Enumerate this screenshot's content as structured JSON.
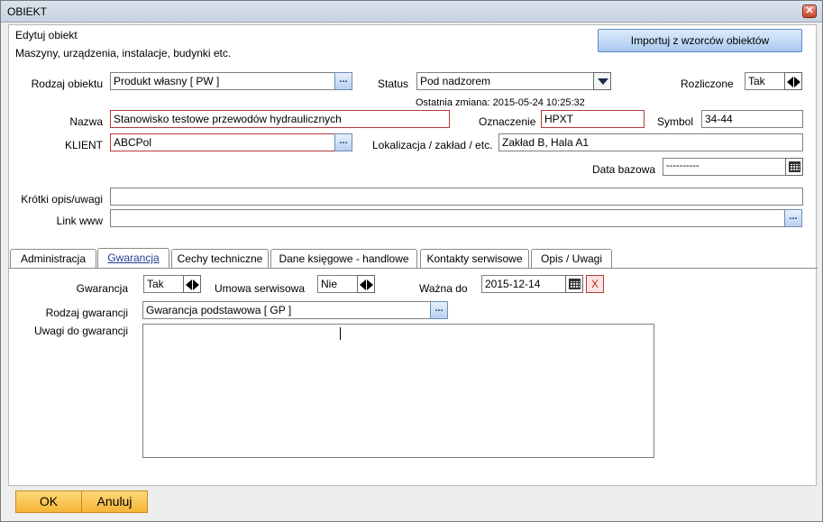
{
  "window": {
    "title": "OBIEKT"
  },
  "header": {
    "heading": "Edytuj obiekt",
    "subheading": "Maszyny, urządzenia, instalacje, budynki etc.",
    "import_button": "Importuj z wzorców obiektów"
  },
  "form": {
    "rodzaj_label": "Rodzaj obiektu",
    "rodzaj_value": "Produkt własny [ PW ]",
    "status_label": "Status",
    "status_value": "Pod nadzorem",
    "rozliczone_label": "Rozliczone",
    "rozliczone_value": "Tak",
    "last_change": "Ostatnia zmiana: 2015-05-24 10:25:32",
    "nazwa_label": "Nazwa",
    "nazwa_value": "Stanowisko testowe przewodów hydraulicznych",
    "oznaczenie_label": "Oznaczenie",
    "oznaczenie_value": "HPXT",
    "symbol_label": "Symbol",
    "symbol_value": "34-44",
    "klient_label": "KLIENT",
    "klient_value": "ABCPol",
    "lokalizacja_label": "Lokalizacja / zakład / etc.",
    "lokalizacja_value": "Zakład B, Hala A1",
    "data_bazowa_label": "Data bazowa",
    "data_bazowa_value": "----------",
    "opis_label": "Krótki opis/uwagi",
    "opis_value": "",
    "link_label": "Link www",
    "link_value": "",
    "dots": "..."
  },
  "tabs": [
    {
      "label": "Administracja"
    },
    {
      "label": "Gwarancja"
    },
    {
      "label": "Cechy techniczne"
    },
    {
      "label": "Dane księgowe - handlowe"
    },
    {
      "label": "Kontakty serwisowe"
    },
    {
      "label": "Opis / Uwagi"
    }
  ],
  "warranty": {
    "gwarancja_label": "Gwarancja",
    "gwarancja_value": "Tak",
    "umowa_label": "Umowa serwisowa",
    "umowa_value": "Nie",
    "wazna_label": "Ważna do",
    "wazna_value": "2015-12-14",
    "clear": "X",
    "rodzaj_label": "Rodzaj gwarancji",
    "rodzaj_value": "Gwarancja podstawowa [ GP ]",
    "uwagi_label": "Uwagi do gwarancji",
    "uwagi_value": ""
  },
  "footer": {
    "ok": "OK",
    "cancel": "Anuluj"
  }
}
